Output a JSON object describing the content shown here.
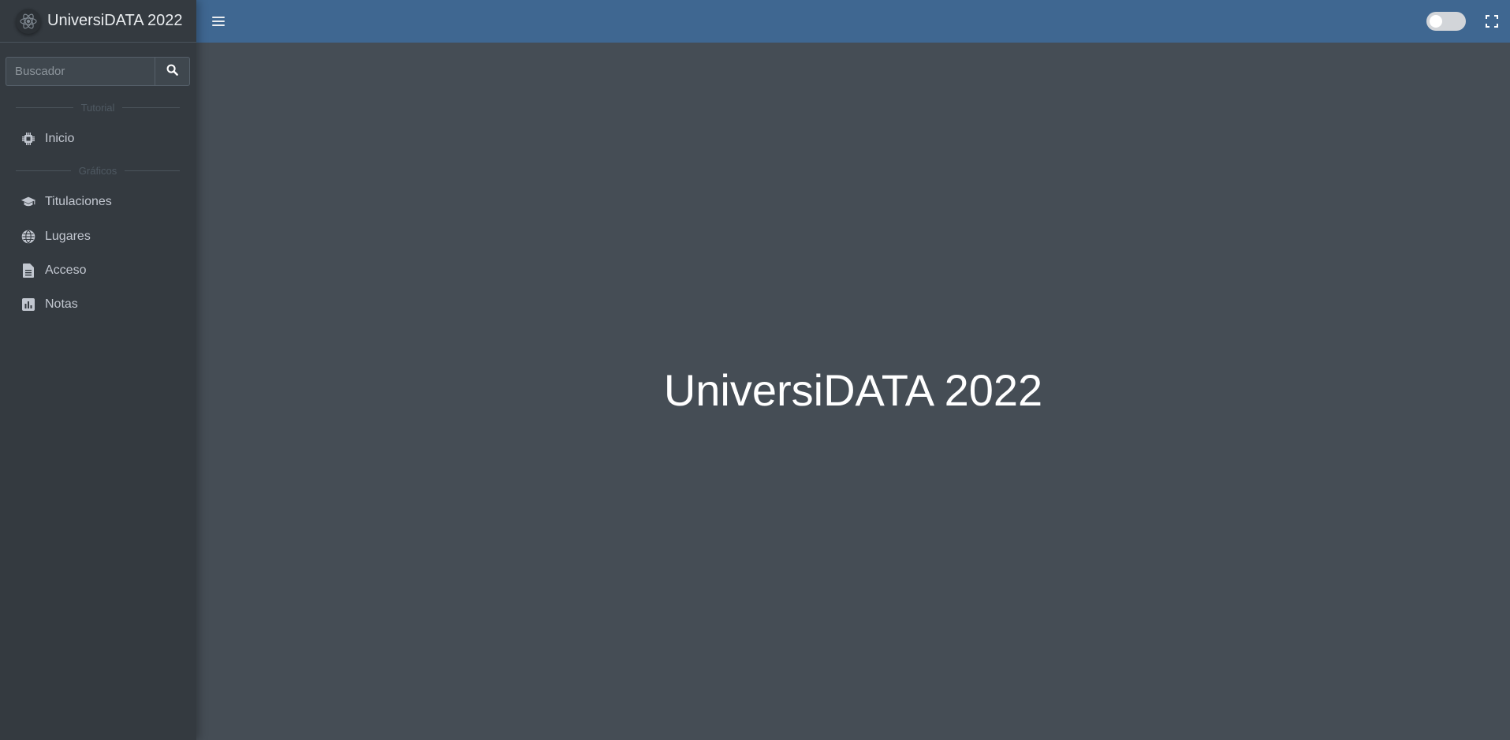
{
  "brand": {
    "name": "UniversiDATA 2022",
    "logo_icon": "atom-icon"
  },
  "search": {
    "placeholder": "Buscador",
    "button_icon": "search-icon"
  },
  "sidebar": {
    "sections": [
      {
        "header": "Tutorial",
        "items": [
          {
            "label": "Inicio",
            "icon": "chip-icon"
          }
        ]
      },
      {
        "header": "Gráficos",
        "items": [
          {
            "label": "Titulaciones",
            "icon": "graduation-cap-icon"
          },
          {
            "label": "Lugares",
            "icon": "globe-icon"
          },
          {
            "label": "Acceso",
            "icon": "document-icon"
          },
          {
            "label": "Notas",
            "icon": "bar-chart-icon"
          }
        ]
      }
    ]
  },
  "topbar": {
    "menu_icon": "hamburger-icon",
    "theme_toggle": {
      "state": "off"
    },
    "fullscreen_icon": "expand-icon"
  },
  "main": {
    "title": "UniversiDATA 2022"
  },
  "colors": {
    "sidebar_bg": "#343a40",
    "topbar_bg": "#3f6791",
    "content_bg": "#454d55",
    "text_light": "#c2c7d0"
  }
}
